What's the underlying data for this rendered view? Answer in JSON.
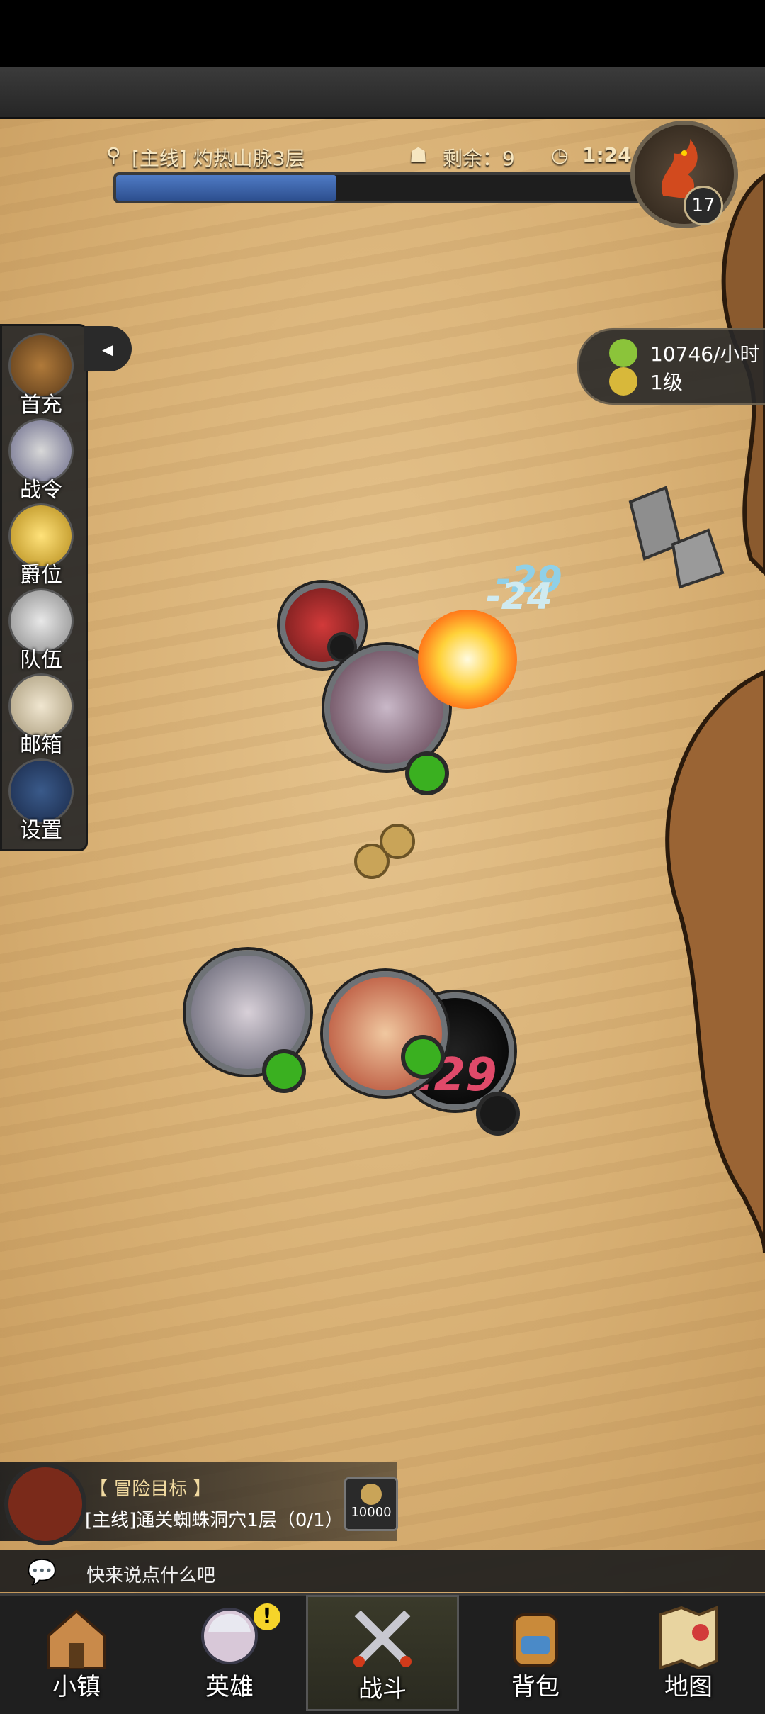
{
  "hud": {
    "quest_name": "[主线] 灼热山脉3层",
    "remaining_label": "剩余：9",
    "timer": "1:24",
    "stage_progress": 0.42,
    "boss_level": "17"
  },
  "side_menu": {
    "items": [
      {
        "label": "首充",
        "icon": "treasure-chest-icon"
      },
      {
        "label": "战令",
        "icon": "battle-pass-icon"
      },
      {
        "label": "爵位",
        "icon": "crown-icon"
      },
      {
        "label": "队伍",
        "icon": "team-icon"
      },
      {
        "label": "邮箱",
        "icon": "mail-icon"
      },
      {
        "label": "设置",
        "icon": "gear-icon"
      }
    ],
    "collapse_glyph": "◂"
  },
  "resources": {
    "rate": "10746/小时",
    "level": "1级"
  },
  "battle": {
    "damage_numbers": [
      "-29",
      "-24",
      "129"
    ]
  },
  "objective": {
    "title": "【 冒险目标 】",
    "description": "[主线]通关蜘蛛洞穴1层（0/1）",
    "reward_amount": "10000"
  },
  "chat": {
    "placeholder": "快来说点什么吧"
  },
  "bottom_nav": {
    "items": [
      {
        "label": "小镇",
        "icon": "town-icon"
      },
      {
        "label": "英雄",
        "icon": "hero-icon"
      },
      {
        "label": "战斗",
        "icon": "crossed-swords-icon"
      },
      {
        "label": "背包",
        "icon": "backpack-icon"
      },
      {
        "label": "地图",
        "icon": "map-icon"
      }
    ],
    "active_index": 2,
    "hero_badge": "!"
  },
  "colors": {
    "sand": "#d8b074",
    "progress_blue": "#4f7bc5",
    "status_green": "#3ab020",
    "badge_yellow": "#f5d42a"
  }
}
